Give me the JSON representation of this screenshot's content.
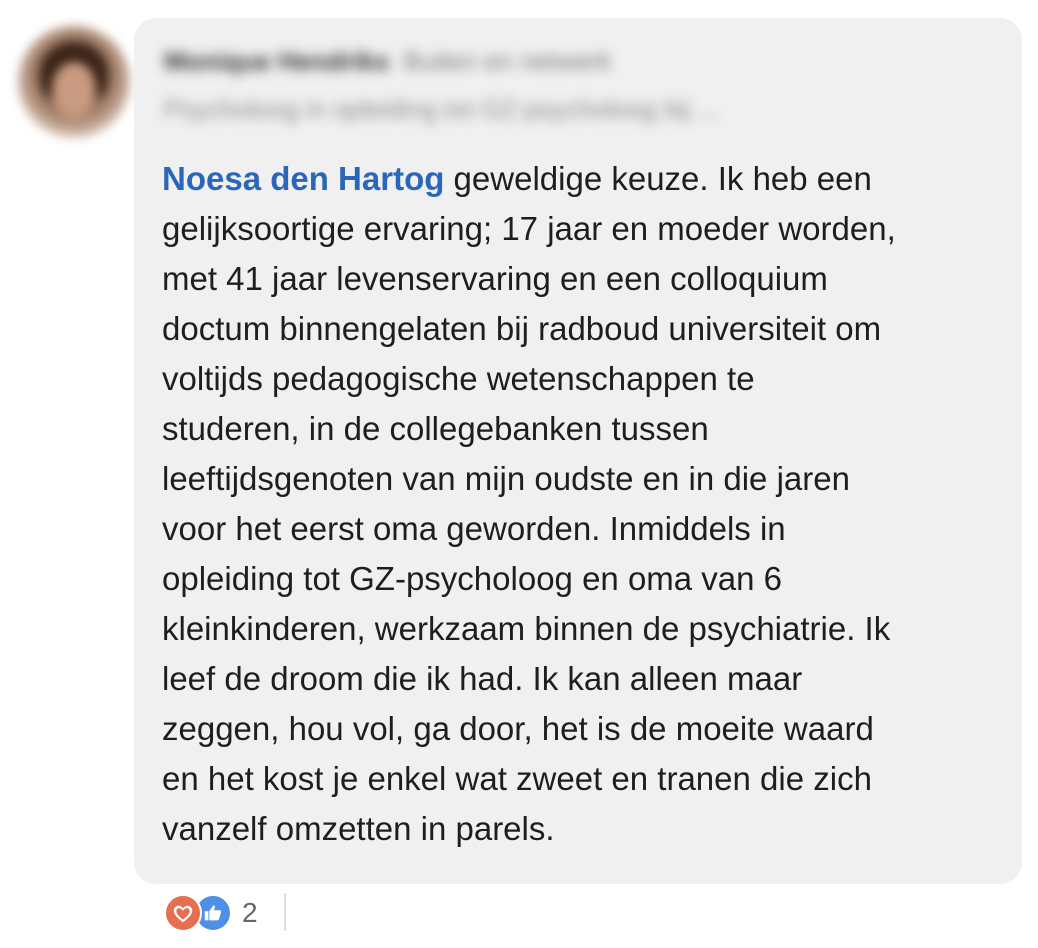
{
  "comment": {
    "author": {
      "name": "Monique Hendriks",
      "role": "Buiten en netwerk",
      "subtitle": "Psycholoog in opleiding tot GZ-psycholoog bij ..."
    },
    "mention": "Noesa den Hartog",
    "lines": [
      " geweldige keuze. Ik heb een",
      "gelijksoortige ervaring; 17 jaar en moeder worden,",
      "met 41 jaar levenservaring en een colloquium",
      "doctum binnengelaten bij radboud universiteit om",
      "voltijds pedagogische wetenschappen te",
      "studeren, in de collegebanken tussen",
      "leeftijdsgenoten van mijn oudste en in die jaren",
      "voor het eerst oma geworden. Inmiddels in",
      "opleiding tot GZ-psycholoog en oma van 6",
      "kleinkinderen, werkzaam binnen de psychiatrie. Ik",
      "leef de droom die ik had. Ik kan alleen maar",
      "zeggen, hou vol, ga door, het is de moeite waard",
      "en het kost je enkel wat zweet en tranen die zich",
      "vanzelf omzetten in parels."
    ]
  },
  "reactions": {
    "types": [
      "heart-icon",
      "thumbs-up-icon"
    ],
    "count": "2",
    "colors": {
      "love": "#e56f52",
      "like": "#4f8fe6"
    }
  }
}
